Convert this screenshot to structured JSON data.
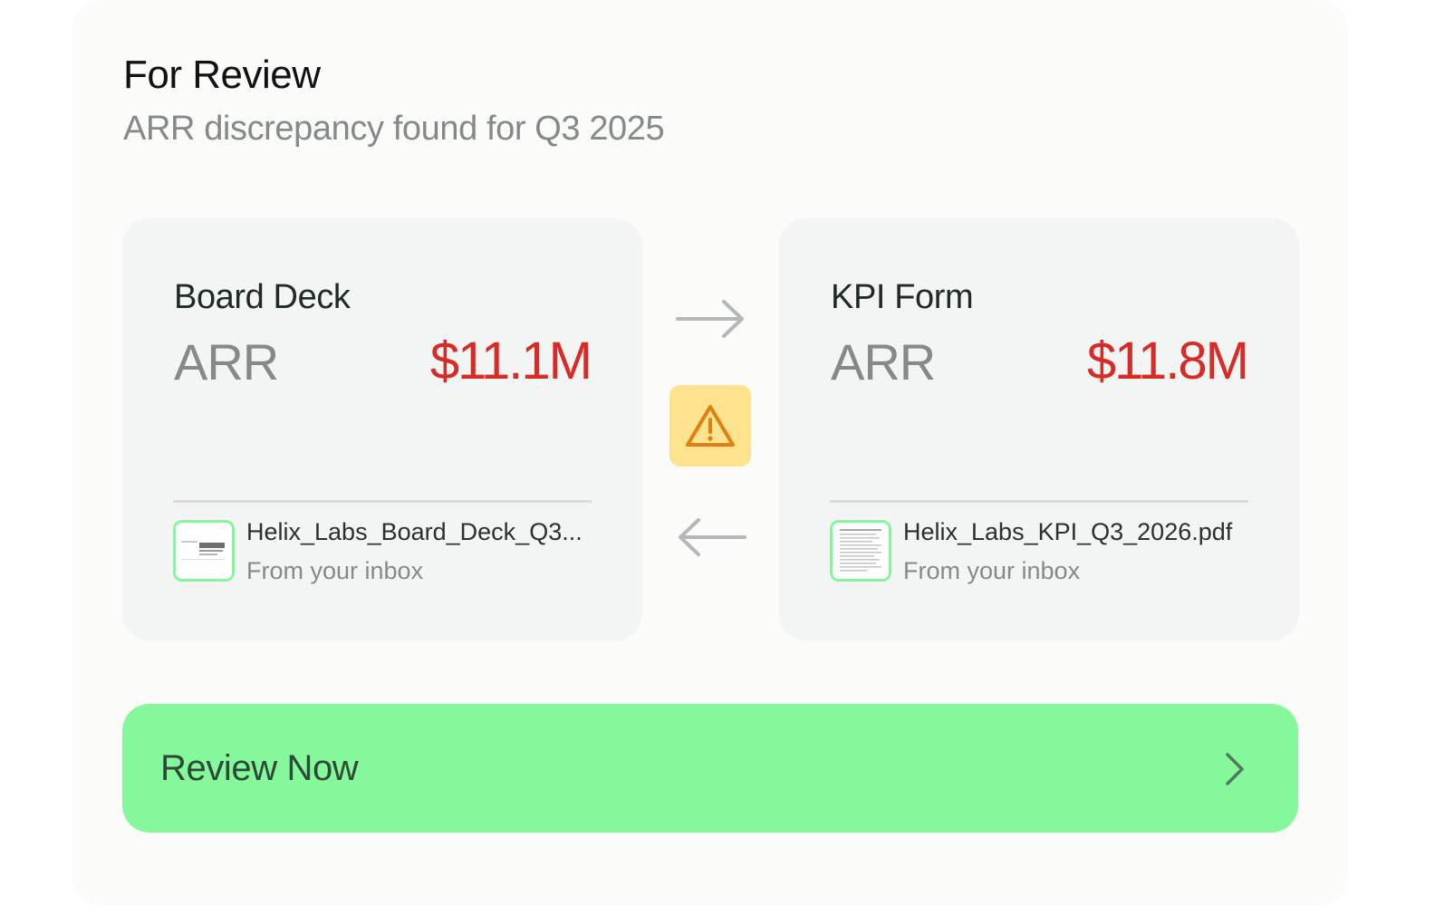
{
  "header": {
    "title": "For Review",
    "subtitle": "ARR discrepancy found for Q3 2025"
  },
  "cards": [
    {
      "name": "Board Deck",
      "metric_label": "ARR",
      "metric_value": "$11.1M",
      "file_name": "Helix_Labs_Board_Deck_Q3...",
      "file_source": "From your inbox"
    },
    {
      "name": "KPI Form",
      "metric_label": "ARR",
      "metric_value": "$11.8M",
      "file_name": "Helix_Labs_KPI_Q3_2026.pdf",
      "file_source": "From your inbox"
    }
  ],
  "comparison": {
    "forward_icon": "arrow-right-icon",
    "back_icon": "arrow-left-icon",
    "status_icon": "warning-icon"
  },
  "action": {
    "label": "Review Now",
    "icon": "chevron-right-icon"
  },
  "colors": {
    "mismatch_value": "#d92a26",
    "warning_bg": "#fde38e",
    "warning_icon": "#e07f12",
    "primary_button": "#84f89a",
    "thumb_border": "#86f59b"
  }
}
